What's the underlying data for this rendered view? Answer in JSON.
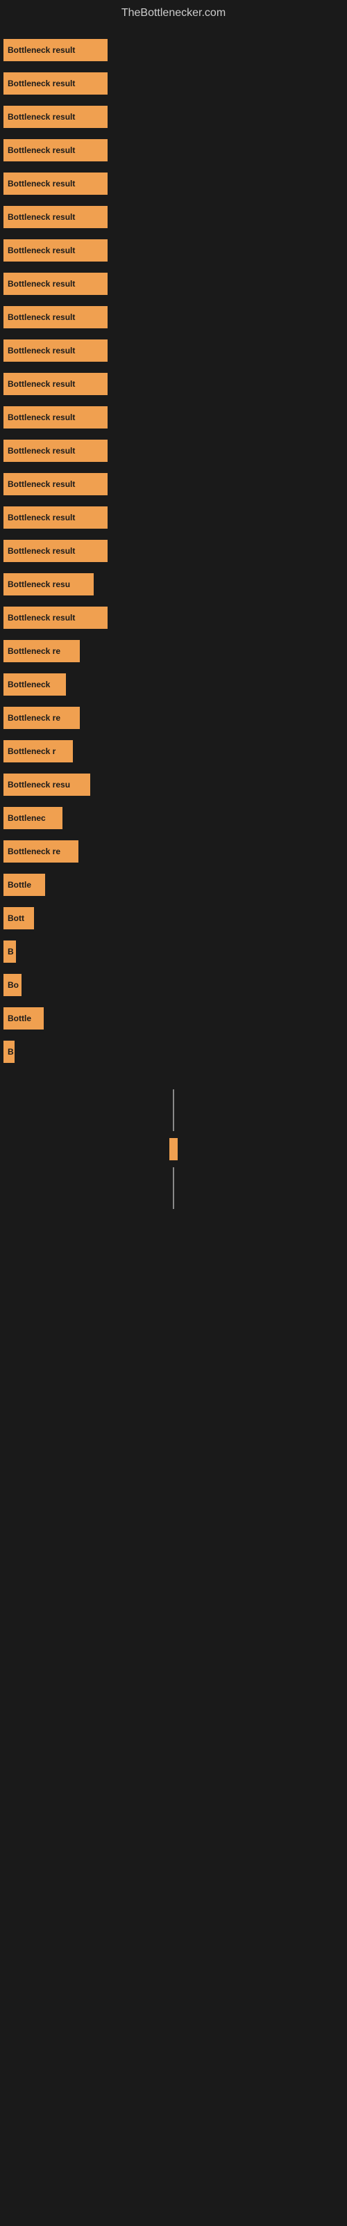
{
  "site": {
    "title": "TheBottlenecker.com"
  },
  "bars": [
    {
      "id": 1,
      "label": "Bottleneck result",
      "width": 150
    },
    {
      "id": 2,
      "label": "Bottleneck result",
      "width": 150
    },
    {
      "id": 3,
      "label": "Bottleneck result",
      "width": 150
    },
    {
      "id": 4,
      "label": "Bottleneck result",
      "width": 150
    },
    {
      "id": 5,
      "label": "Bottleneck result",
      "width": 150
    },
    {
      "id": 6,
      "label": "Bottleneck result",
      "width": 150
    },
    {
      "id": 7,
      "label": "Bottleneck result",
      "width": 150
    },
    {
      "id": 8,
      "label": "Bottleneck result",
      "width": 150
    },
    {
      "id": 9,
      "label": "Bottleneck result",
      "width": 150
    },
    {
      "id": 10,
      "label": "Bottleneck result",
      "width": 150
    },
    {
      "id": 11,
      "label": "Bottleneck result",
      "width": 150
    },
    {
      "id": 12,
      "label": "Bottleneck result",
      "width": 150
    },
    {
      "id": 13,
      "label": "Bottleneck result",
      "width": 150
    },
    {
      "id": 14,
      "label": "Bottleneck result",
      "width": 150
    },
    {
      "id": 15,
      "label": "Bottleneck result",
      "width": 150
    },
    {
      "id": 16,
      "label": "Bottleneck result",
      "width": 150
    },
    {
      "id": 17,
      "label": "Bottleneck resu",
      "width": 130
    },
    {
      "id": 18,
      "label": "Bottleneck result",
      "width": 150
    },
    {
      "id": 19,
      "label": "Bottleneck re",
      "width": 110
    },
    {
      "id": 20,
      "label": "Bottleneck",
      "width": 90
    },
    {
      "id": 21,
      "label": "Bottleneck re",
      "width": 110
    },
    {
      "id": 22,
      "label": "Bottleneck r",
      "width": 100
    },
    {
      "id": 23,
      "label": "Bottleneck resu",
      "width": 125
    },
    {
      "id": 24,
      "label": "Bottlenec",
      "width": 85
    },
    {
      "id": 25,
      "label": "Bottleneck re",
      "width": 108
    },
    {
      "id": 26,
      "label": "Bottle",
      "width": 60
    },
    {
      "id": 27,
      "label": "Bott",
      "width": 44
    },
    {
      "id": 28,
      "label": "B",
      "width": 18
    },
    {
      "id": 29,
      "label": "Bo",
      "width": 26
    },
    {
      "id": 30,
      "label": "Bottle",
      "width": 58
    },
    {
      "id": 31,
      "label": "B",
      "width": 16
    }
  ],
  "bottom": {
    "line1_height": 60,
    "line2_height": 60,
    "small_bar_label": "▌",
    "small_bar_width": 8
  },
  "colors": {
    "background": "#1a1a1a",
    "bar": "#f0a050",
    "title": "#cccccc",
    "line": "#888888"
  }
}
